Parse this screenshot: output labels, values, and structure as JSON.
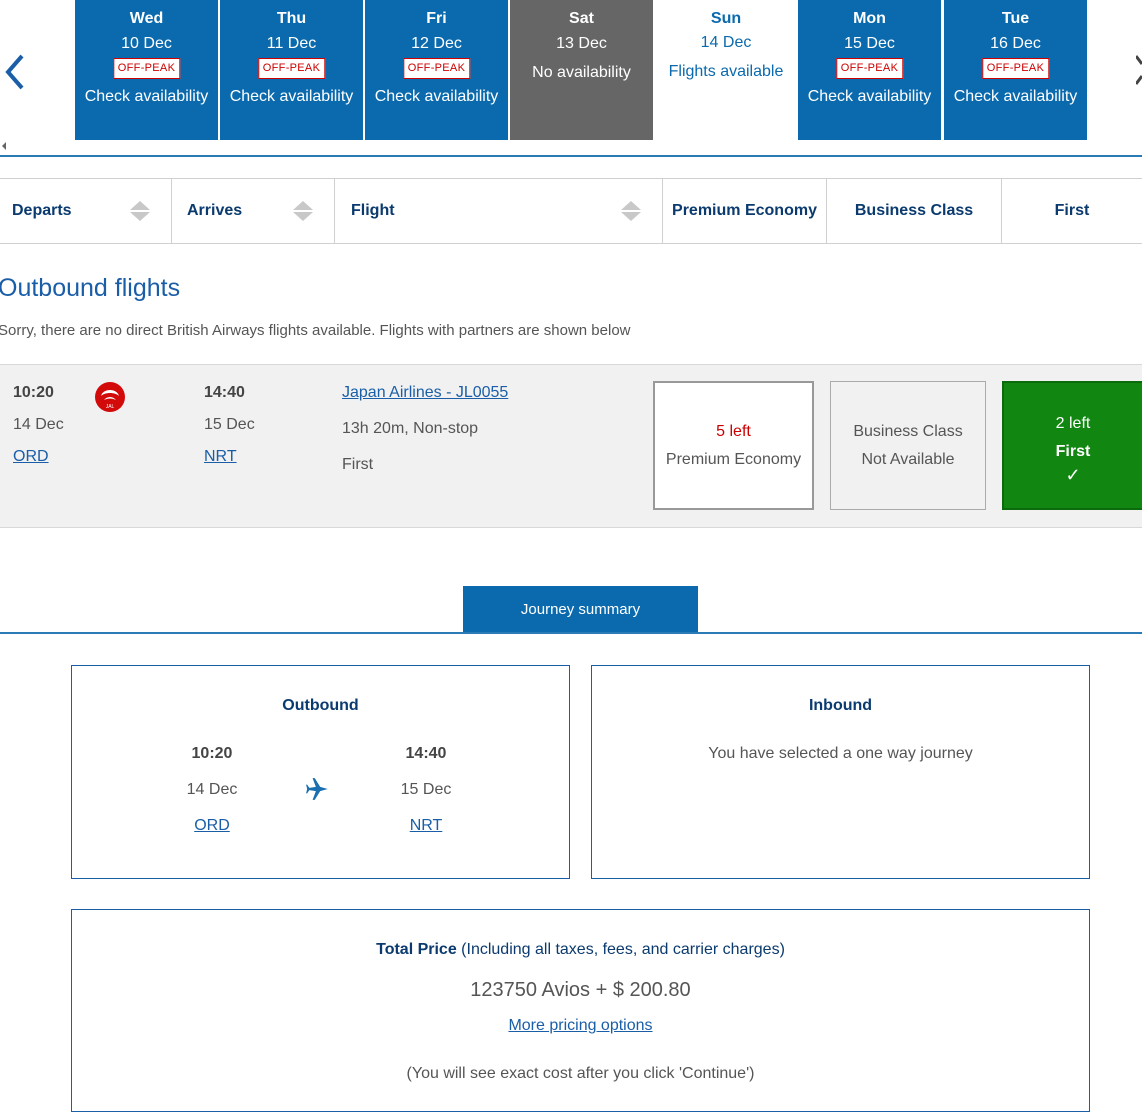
{
  "date_strip": {
    "days": [
      {
        "day": "Wed",
        "date": "10 Dec",
        "badge": "OFF-PEAK",
        "status": "Check availability"
      },
      {
        "day": "Thu",
        "date": "11 Dec",
        "badge": "OFF-PEAK",
        "status": "Check availability"
      },
      {
        "day": "Fri",
        "date": "12 Dec",
        "badge": "OFF-PEAK",
        "status": "Check availability"
      },
      {
        "day": "Sat",
        "date": "13 Dec",
        "badge": "",
        "status": "No availability"
      },
      {
        "day": "Sun",
        "date": "14 Dec",
        "badge": "",
        "status": "Flights available"
      },
      {
        "day": "Mon",
        "date": "15 Dec",
        "badge": "OFF-PEAK",
        "status": "Check availability"
      },
      {
        "day": "Tue",
        "date": "16 Dec",
        "badge": "OFF-PEAK",
        "status": "Check availability"
      }
    ],
    "selected_index": 4
  },
  "table_header": {
    "departs": "Departs",
    "arrives": "Arrives",
    "flight": "Flight",
    "premium_economy": "Premium Economy",
    "business": "Business Class",
    "first": "First"
  },
  "outbound": {
    "title": "Outbound flights",
    "notice": "Sorry, there are no direct British Airways flights available. Flights with partners are shown below",
    "flight": {
      "dep_time": "10:20",
      "dep_date": "14 Dec",
      "dep_airport": "ORD",
      "arr_time": "14:40",
      "arr_date": "15 Dec",
      "arr_airport": "NRT",
      "flight_link": "Japan Airlines - JL0055",
      "duration": "13h 20m, Non-stop",
      "cabin": "First",
      "airline_logo_text": "JAL",
      "fares": {
        "premium_economy": {
          "seats": "5 left",
          "label": "Premium Economy"
        },
        "business": {
          "line1": "Business Class",
          "line2": "Not Available"
        },
        "first": {
          "seats": "2 left",
          "label": "First",
          "check": "✓"
        }
      }
    }
  },
  "journey_summary": {
    "tab": "Journey summary",
    "outbound": {
      "title": "Outbound",
      "dep_time": "10:20",
      "dep_date": "14 Dec",
      "dep_airport": "ORD",
      "arr_time": "14:40",
      "arr_date": "15 Dec",
      "arr_airport": "NRT"
    },
    "inbound": {
      "title": "Inbound",
      "message": "You have selected a one way journey"
    },
    "price": {
      "label_bold": "Total Price",
      "label_rest": " (Including all taxes, fees, and carrier charges)",
      "amount": "123750 Avios + $ 200.80",
      "more_link": "More pricing options",
      "note": "(You will see exact cost after you click 'Continue')"
    }
  },
  "colors": {
    "brand_blue": "#0a6aad",
    "navy": "#0a3a6e",
    "unavailable_grey": "#666666",
    "selected_green": "#118711",
    "offpeak_red": "#cc0000"
  }
}
